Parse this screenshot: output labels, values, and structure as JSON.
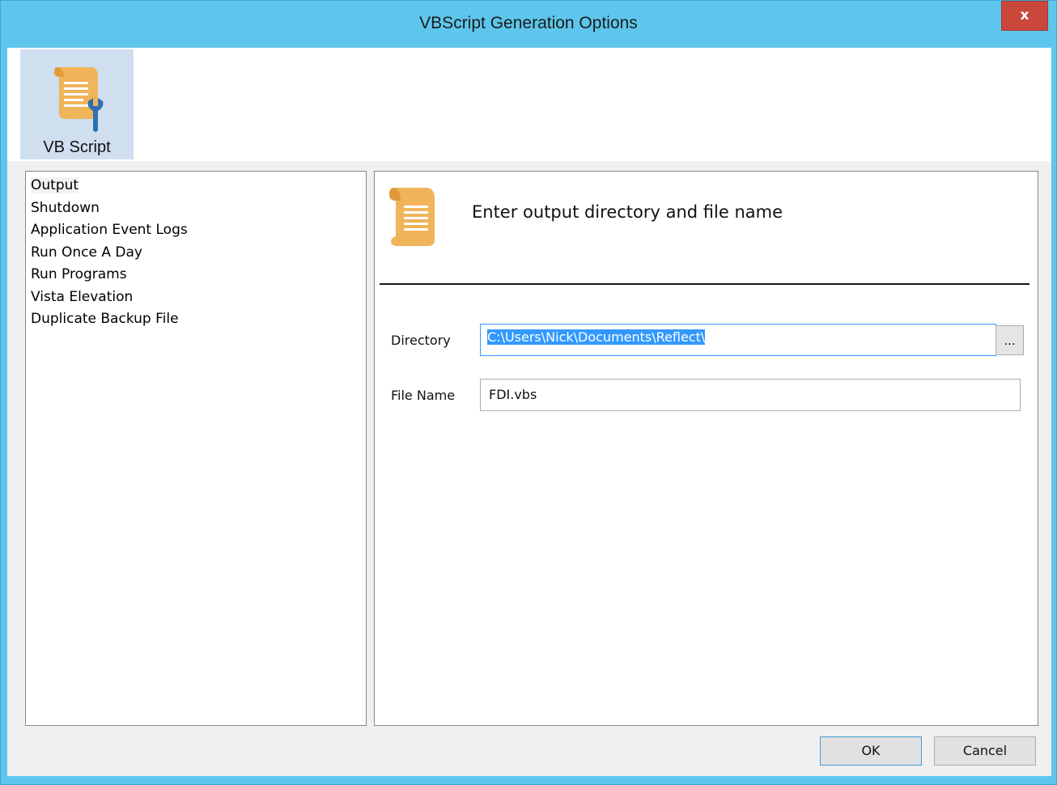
{
  "window": {
    "title": "VBScript Generation Options",
    "close_label": "x"
  },
  "ribbon": {
    "button_label": "VB Script",
    "icon": "script-wrench-icon"
  },
  "nav": {
    "items": [
      {
        "label": "Output",
        "selected": true
      },
      {
        "label": "Shutdown",
        "selected": false
      },
      {
        "label": "Application Event Logs",
        "selected": false
      },
      {
        "label": "Run Once A Day",
        "selected": false
      },
      {
        "label": "Run Programs",
        "selected": false
      },
      {
        "label": "Vista Elevation",
        "selected": false
      },
      {
        "label": "Duplicate Backup File",
        "selected": false
      }
    ]
  },
  "panel": {
    "icon": "script-scroll-icon",
    "heading": "Enter output directory and file name",
    "directory_label": "Directory",
    "directory_value": "C:\\Users\\Nick\\Documents\\Reflect\\",
    "browse_label": "...",
    "filename_label": "File Name",
    "filename_value": "FDI.vbs"
  },
  "footer": {
    "ok_label": "OK",
    "cancel_label": "Cancel"
  },
  "colors": {
    "frame": "#5ec6ec",
    "close_button": "#c9483b",
    "ribbon_selected": "#cfdff0",
    "selection": "#3399ff",
    "scroll_icon": "#f0b45a"
  }
}
